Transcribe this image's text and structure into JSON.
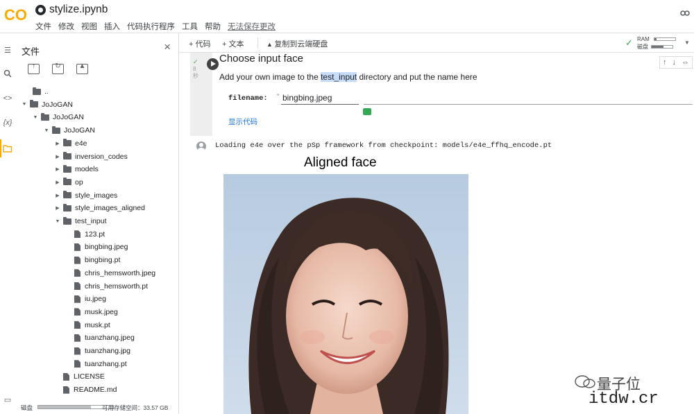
{
  "header": {
    "notebook_title": "stylize.ipynb",
    "menu": [
      "文件",
      "修改",
      "视图",
      "插入",
      "代码执行程序",
      "工具",
      "帮助"
    ],
    "unsaved": "无法保存更改",
    "logo_text": "CO",
    "logo_color": "#f9ab00"
  },
  "rail": {
    "icons": [
      "menu-icon",
      "search-icon",
      "code-icon",
      "variables-icon",
      "folder-icon"
    ],
    "variables_label": "{x}"
  },
  "files": {
    "title": "文件",
    "close": "×",
    "tools": [
      "upload-icon",
      "refresh-icon",
      "drive-icon"
    ],
    "parent": "..",
    "tree": [
      {
        "name": "JoJoGAN",
        "type": "folder",
        "open": true
      },
      {
        "name": "JoJoGAN",
        "type": "folder",
        "open": true
      },
      {
        "name": "JoJoGAN",
        "type": "folder",
        "open": true
      },
      {
        "name": "e4e",
        "type": "folder",
        "open": false
      },
      {
        "name": "inversion_codes",
        "type": "folder",
        "open": false
      },
      {
        "name": "models",
        "type": "folder",
        "open": false
      },
      {
        "name": "op",
        "type": "folder",
        "open": false
      },
      {
        "name": "style_images",
        "type": "folder",
        "open": false
      },
      {
        "name": "style_images_aligned",
        "type": "folder",
        "open": false
      },
      {
        "name": "test_input",
        "type": "folder",
        "open": true
      },
      {
        "name": "123.pt",
        "type": "file"
      },
      {
        "name": "bingbing.jpeg",
        "type": "file"
      },
      {
        "name": "bingbing.pt",
        "type": "file"
      },
      {
        "name": "chris_hemsworth.jpeg",
        "type": "file"
      },
      {
        "name": "chris_hemsworth.pt",
        "type": "file"
      },
      {
        "name": "iu.jpeg",
        "type": "file"
      },
      {
        "name": "musk.jpeg",
        "type": "file"
      },
      {
        "name": "musk.pt",
        "type": "file"
      },
      {
        "name": "tuanzhang.jpeg",
        "type": "file"
      },
      {
        "name": "tuanzhang.jpg",
        "type": "file"
      },
      {
        "name": "tuanzhang.pt",
        "type": "file"
      },
      {
        "name": "LICENSE",
        "type": "file"
      },
      {
        "name": "README.md",
        "type": "file"
      }
    ],
    "disk_label": "磁盘",
    "disk_free": "可用存储空间：33.57 GB",
    "disk_used_fraction": 0.7
  },
  "toolbar": {
    "code": "+ 代码",
    "text": "+ 文本",
    "copy_to_drive": "复制到云端硬盘",
    "ram_label": "RAM",
    "disk_label": "磁盘",
    "ram_fraction": 0.12,
    "disk_fraction": 0.55,
    "status_color": "#34a853"
  },
  "cell": {
    "exec_seconds": "8",
    "exec_unit": "秒",
    "title": "Choose input face",
    "desc_before": "Add your own image to the ",
    "desc_highlight": "test_input",
    "desc_after": " directory and put the name here",
    "form_label": "filename:",
    "form_value": "bingbing.jpeg",
    "show_code": "显示代码",
    "cell_tools": [
      "↑",
      "↓",
      "⇔"
    ]
  },
  "output": {
    "log": "Loading e4e over the pSp framework from checkpoint: models/e4e_ffhq_encode.pt",
    "figure_title": "Aligned face"
  },
  "watermark": {
    "brand": "量子位",
    "site": "itdw.cr"
  }
}
